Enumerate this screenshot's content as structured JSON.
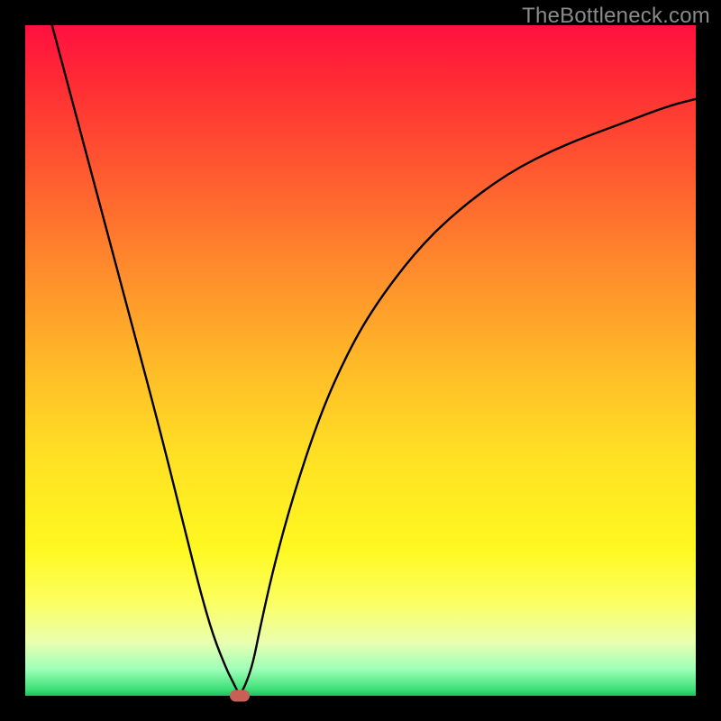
{
  "watermark": "TheBottleneck.com",
  "colors": {
    "frame": "#000000",
    "curve": "#000000",
    "marker": "#c86058",
    "gradient_stops": [
      {
        "at": 0.0,
        "hex": "#ff1040"
      },
      {
        "at": 0.08,
        "hex": "#ff2a34"
      },
      {
        "at": 0.22,
        "hex": "#ff5a30"
      },
      {
        "at": 0.36,
        "hex": "#ff8a2c"
      },
      {
        "at": 0.5,
        "hex": "#ffb828"
      },
      {
        "at": 0.64,
        "hex": "#ffe024"
      },
      {
        "at": 0.78,
        "hex": "#fff820"
      },
      {
        "at": 0.86,
        "hex": "#fbff60"
      },
      {
        "at": 0.92,
        "hex": "#eaffb0"
      },
      {
        "at": 0.96,
        "hex": "#9fffb8"
      },
      {
        "at": 0.99,
        "hex": "#3fe078"
      },
      {
        "at": 1.0,
        "hex": "#20c060"
      }
    ]
  },
  "chart_data": {
    "type": "line",
    "title": "",
    "xlabel": "",
    "ylabel": "",
    "xlim": [
      0,
      100
    ],
    "ylim": [
      0,
      100
    ],
    "series": [
      {
        "name": "bottleneck-curve",
        "x": [
          0,
          4,
          8,
          12,
          16,
          20,
          24,
          26,
          28,
          30,
          31,
          32,
          33,
          34,
          35,
          37,
          40,
          44,
          48,
          52,
          58,
          64,
          72,
          80,
          88,
          96,
          100
        ],
        "y": [
          115,
          100,
          85,
          70,
          55,
          40,
          24,
          16,
          9,
          4,
          2,
          0,
          2,
          5,
          10,
          19,
          30,
          42,
          51,
          58,
          66,
          72,
          78,
          82,
          85,
          88,
          89
        ]
      }
    ],
    "marker": {
      "x": 32,
      "y": 0
    },
    "grid": false,
    "legend": false
  }
}
